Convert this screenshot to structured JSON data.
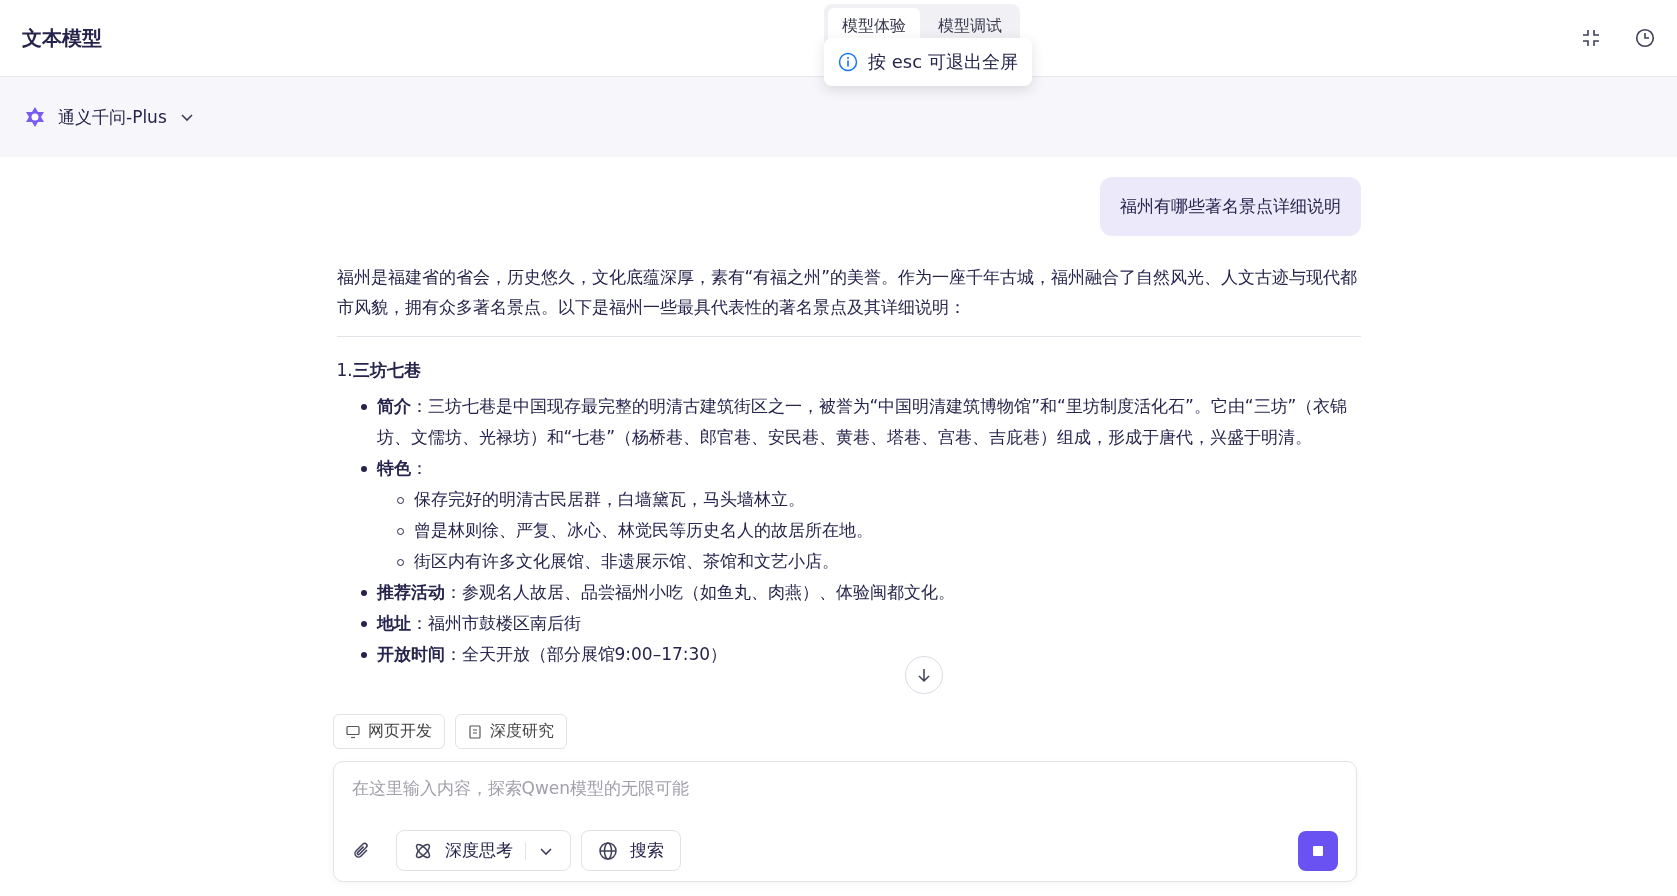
{
  "header": {
    "title": "文本模型",
    "tabs": [
      {
        "label": "模型体验",
        "selected": true
      },
      {
        "label": "模型调试",
        "selected": false
      }
    ]
  },
  "toast": {
    "text": "按 esc 可退出全屏"
  },
  "model_selector": {
    "label": "通义千问-Plus"
  },
  "conversation": {
    "user_message": "福州有哪些著名景点详细说明",
    "intro": "福州是福建省的省会，历史悠久，文化底蕴深厚，素有“有福之州”的美誉。作为一座千年古城，福州融合了自然风光、人文古迹与现代都市风貌，拥有众多著名景点。以下是福州一些最具代表性的著名景点及其详细说明：",
    "sections": [
      {
        "number": "1.",
        "title": "三坊七巷",
        "items": [
          {
            "text": "**简介**：三坊七巷是中国现存最完整的明清古建筑街区之一，被誉为“中国明清建筑博物馆”和“里坊制度活化石”。它由“三坊”（衣锦坊、文儒坊、光禄坊）和“七巷”（杨桥巷、郎官巷、安民巷、黄巷、塔巷、宫巷、吉庇巷）组成，形成于唐代，兴盛于明清。"
          },
          {
            "text": "**特色**：",
            "children": [
              {
                "text": "保存完好的明清古民居群，白墙黛瓦，马头墙林立。"
              },
              {
                "text": "曾是林则徐、严复、冰心、林觉民等历史名人的故居所在地。"
              },
              {
                "text": "街区内有许多文化展馆、非遗展示馆、茶馆和文艺小店。"
              }
            ]
          },
          {
            "text": "**推荐活动**：参观名人故居、品尝福州小吃（如鱼丸、肉燕）、体验闽都文化。"
          },
          {
            "text": "**地址**：福州市鼓楼区南后街"
          },
          {
            "text": "**开放时间**：全天开放（部分展馆9:00–17:30）"
          }
        ]
      }
    ]
  },
  "shortcuts": [
    {
      "label": "网页开发",
      "kind": "monitor"
    },
    {
      "label": "深度研究",
      "kind": "document"
    }
  ],
  "composer": {
    "placeholder": "在这里输入内容，探索Qwen模型的无限可能",
    "deep_think": "深度思考",
    "search": "搜索",
    "generating": true
  }
}
